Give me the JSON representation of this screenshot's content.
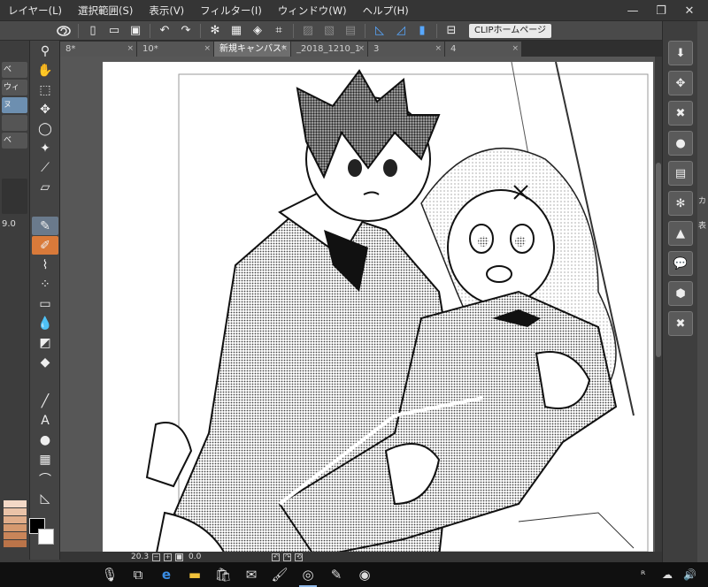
{
  "menu": {
    "items": [
      "レイヤー(L)",
      "選択範囲(S)",
      "表示(V)",
      "フィルター(I)",
      "ウィンドウ(W)",
      "ヘルプ(H)"
    ]
  },
  "window_controls": {
    "minimize": "—",
    "maximize": "❐",
    "close": "✕"
  },
  "toolbar": {
    "clip_home_label": "CLIPホームページ"
  },
  "tabs": [
    {
      "label": "8*",
      "active": false
    },
    {
      "label": "10*",
      "active": false
    },
    {
      "label": "新規キャンバス*",
      "active": true
    },
    {
      "label": "_2018_1210_1",
      "active": false
    },
    {
      "label": "3",
      "active": false
    },
    {
      "label": "4",
      "active": false
    }
  ],
  "tab_close_glyph": "×",
  "left_panel": {
    "sub_tool_rows": [
      "べ",
      "ウィ",
      "ヌ",
      "",
      "べ"
    ]
  },
  "brush_size": "9.0",
  "palette_colors": [
    "#f3d8c6",
    "#eac3a8",
    "#e0ad8a",
    "#d5996f",
    "#c98559",
    "#bb7449"
  ],
  "statusbar": {
    "zoom": "20.3",
    "rotation": "0.0"
  },
  "right_edge_chars": [
    "カ",
    "表"
  ],
  "taskbar": {
    "icons": [
      "microphone",
      "task-view",
      "edge",
      "file-explorer",
      "store",
      "mail",
      "paint",
      "clip-studio",
      "pen-tablet",
      "clip-studio-alt"
    ],
    "tray": {
      "person": "ᴿ",
      "cloud": "☁",
      "volume": "🔊"
    }
  },
  "colors": {
    "accent": "#58a8ff",
    "active_tool": "#d97a3a"
  }
}
